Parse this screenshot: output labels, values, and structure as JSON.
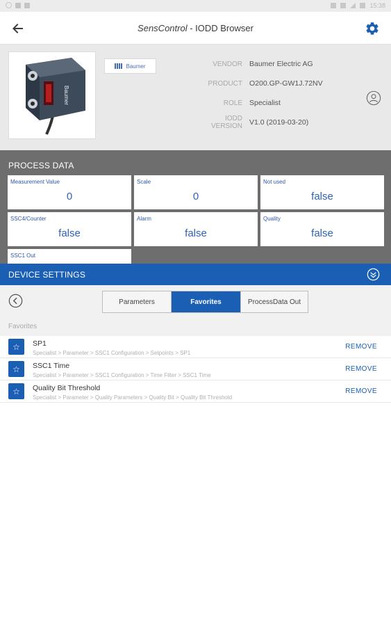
{
  "status_bar": {
    "time": "15:38"
  },
  "app_bar": {
    "title_brand": "SensControl",
    "title_rest": " - IODD Browser"
  },
  "device": {
    "vendor_logo_text": "Baumer",
    "sensor_brand_text": "Baumer",
    "rows": [
      {
        "label": "VENDOR",
        "value": "Baumer Electric AG"
      },
      {
        "label": "PRODUCT",
        "value": "O200.GP-GW1J.72NV"
      },
      {
        "label": "ROLE",
        "value": "Specialist"
      },
      {
        "label": "IODD VERSION",
        "value": "V1.0 (2019-03-20)"
      }
    ]
  },
  "process_data": {
    "title": "PROCESS DATA",
    "cards": [
      {
        "label": "Measurement Value",
        "value": "0"
      },
      {
        "label": "Scale",
        "value": "0"
      },
      {
        "label": "Not used",
        "value": "false"
      },
      {
        "label": "SSC4/Counter",
        "value": "false"
      },
      {
        "label": "Alarm",
        "value": "false"
      },
      {
        "label": "Quality",
        "value": "false"
      },
      {
        "label": "SSC1 Out",
        "value": ""
      }
    ]
  },
  "device_settings": {
    "title": "DEVICE SETTINGS",
    "tabs": [
      "Parameters",
      "Favorites",
      "ProcessData Out"
    ],
    "favorites_header": "Favorites",
    "remove_label": "REMOVE",
    "favorites": [
      {
        "name": "SP1",
        "path": "Specialist > Parameter > SSC1 Configuration > Setpoints > SP1"
      },
      {
        "name": "SSC1 Time",
        "path": "Specialist > Parameter > SSC1 Configuration > Time Filter > SSC1 Time"
      },
      {
        "name": "Quality Bit Threshold",
        "path": "Specialist > Parameter > Quality Parameters > Quality Bit > Quality Bit Threshold"
      }
    ]
  },
  "colors": {
    "accent": "#1a5fb4",
    "process_bg": "#6e6e6e",
    "header_bg": "#e9e9e9"
  }
}
